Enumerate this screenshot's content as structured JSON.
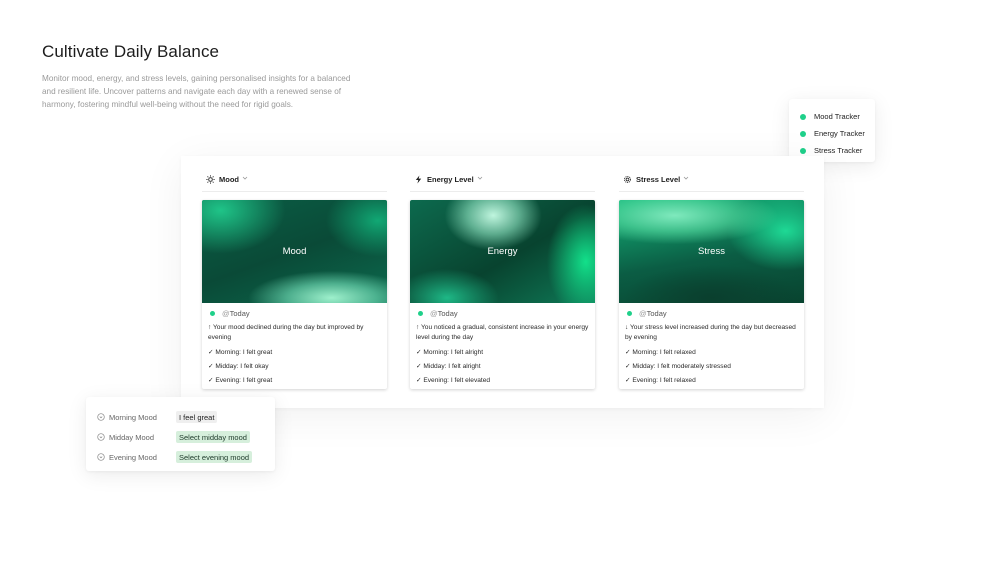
{
  "hero": {
    "title": "Cultivate Daily Balance",
    "description": "Monitor mood, energy, and stress levels, gaining personalised insights for a balanced and resilient life. Uncover patterns and navigate each day with a renewed sense of harmony, fostering mindful well-being without the need for rigid goals."
  },
  "legend": {
    "items": [
      {
        "label": "Mood Tracker",
        "color": "#1fd08a"
      },
      {
        "label": "Energy Tracker",
        "color": "#1fd08a"
      },
      {
        "label": "Stress Tracker",
        "color": "#1fd08a"
      }
    ]
  },
  "columns": [
    {
      "header": "Mood",
      "icon": "sun-icon",
      "image_label": "Mood",
      "date_prefix": "@",
      "date": "Today",
      "summary": "↑ Your mood declined during the day but improved by evening",
      "entries": [
        "✓ Morning: I felt great",
        "✓ Midday: I felt okay",
        "✓ Evening: I felt great"
      ]
    },
    {
      "header": "Energy Level",
      "icon": "lightning-icon",
      "image_label": "Energy",
      "date_prefix": "@",
      "date": "Today",
      "summary": "↑ You noticed a gradual, consistent increase in your energy level during the day",
      "entries": [
        "✓ Morning: I felt alright",
        "✓ Midday: I felt alright",
        "✓ Evening: I felt elevated"
      ]
    },
    {
      "header": "Stress Level",
      "icon": "gear-icon",
      "image_label": "Stress",
      "date_prefix": "@",
      "date": "Today",
      "summary": "↓ Your stress level increased during the day but decreased by evening",
      "entries": [
        "✓ Morning: I felt relaxed",
        "✓ Midday: I felt moderately stressed",
        "✓ Evening: I felt relaxed"
      ]
    }
  ],
  "mood_inputs": [
    {
      "label": "Morning Mood",
      "value": "I feel great"
    },
    {
      "label": "Midday Mood",
      "value": "Select midday mood"
    },
    {
      "label": "Evening Mood",
      "value": "Select evening mood"
    }
  ],
  "colors": {
    "accent": "#1fd08a",
    "chip_green": "#d6efdc",
    "chip_neutral": "#efefef"
  }
}
